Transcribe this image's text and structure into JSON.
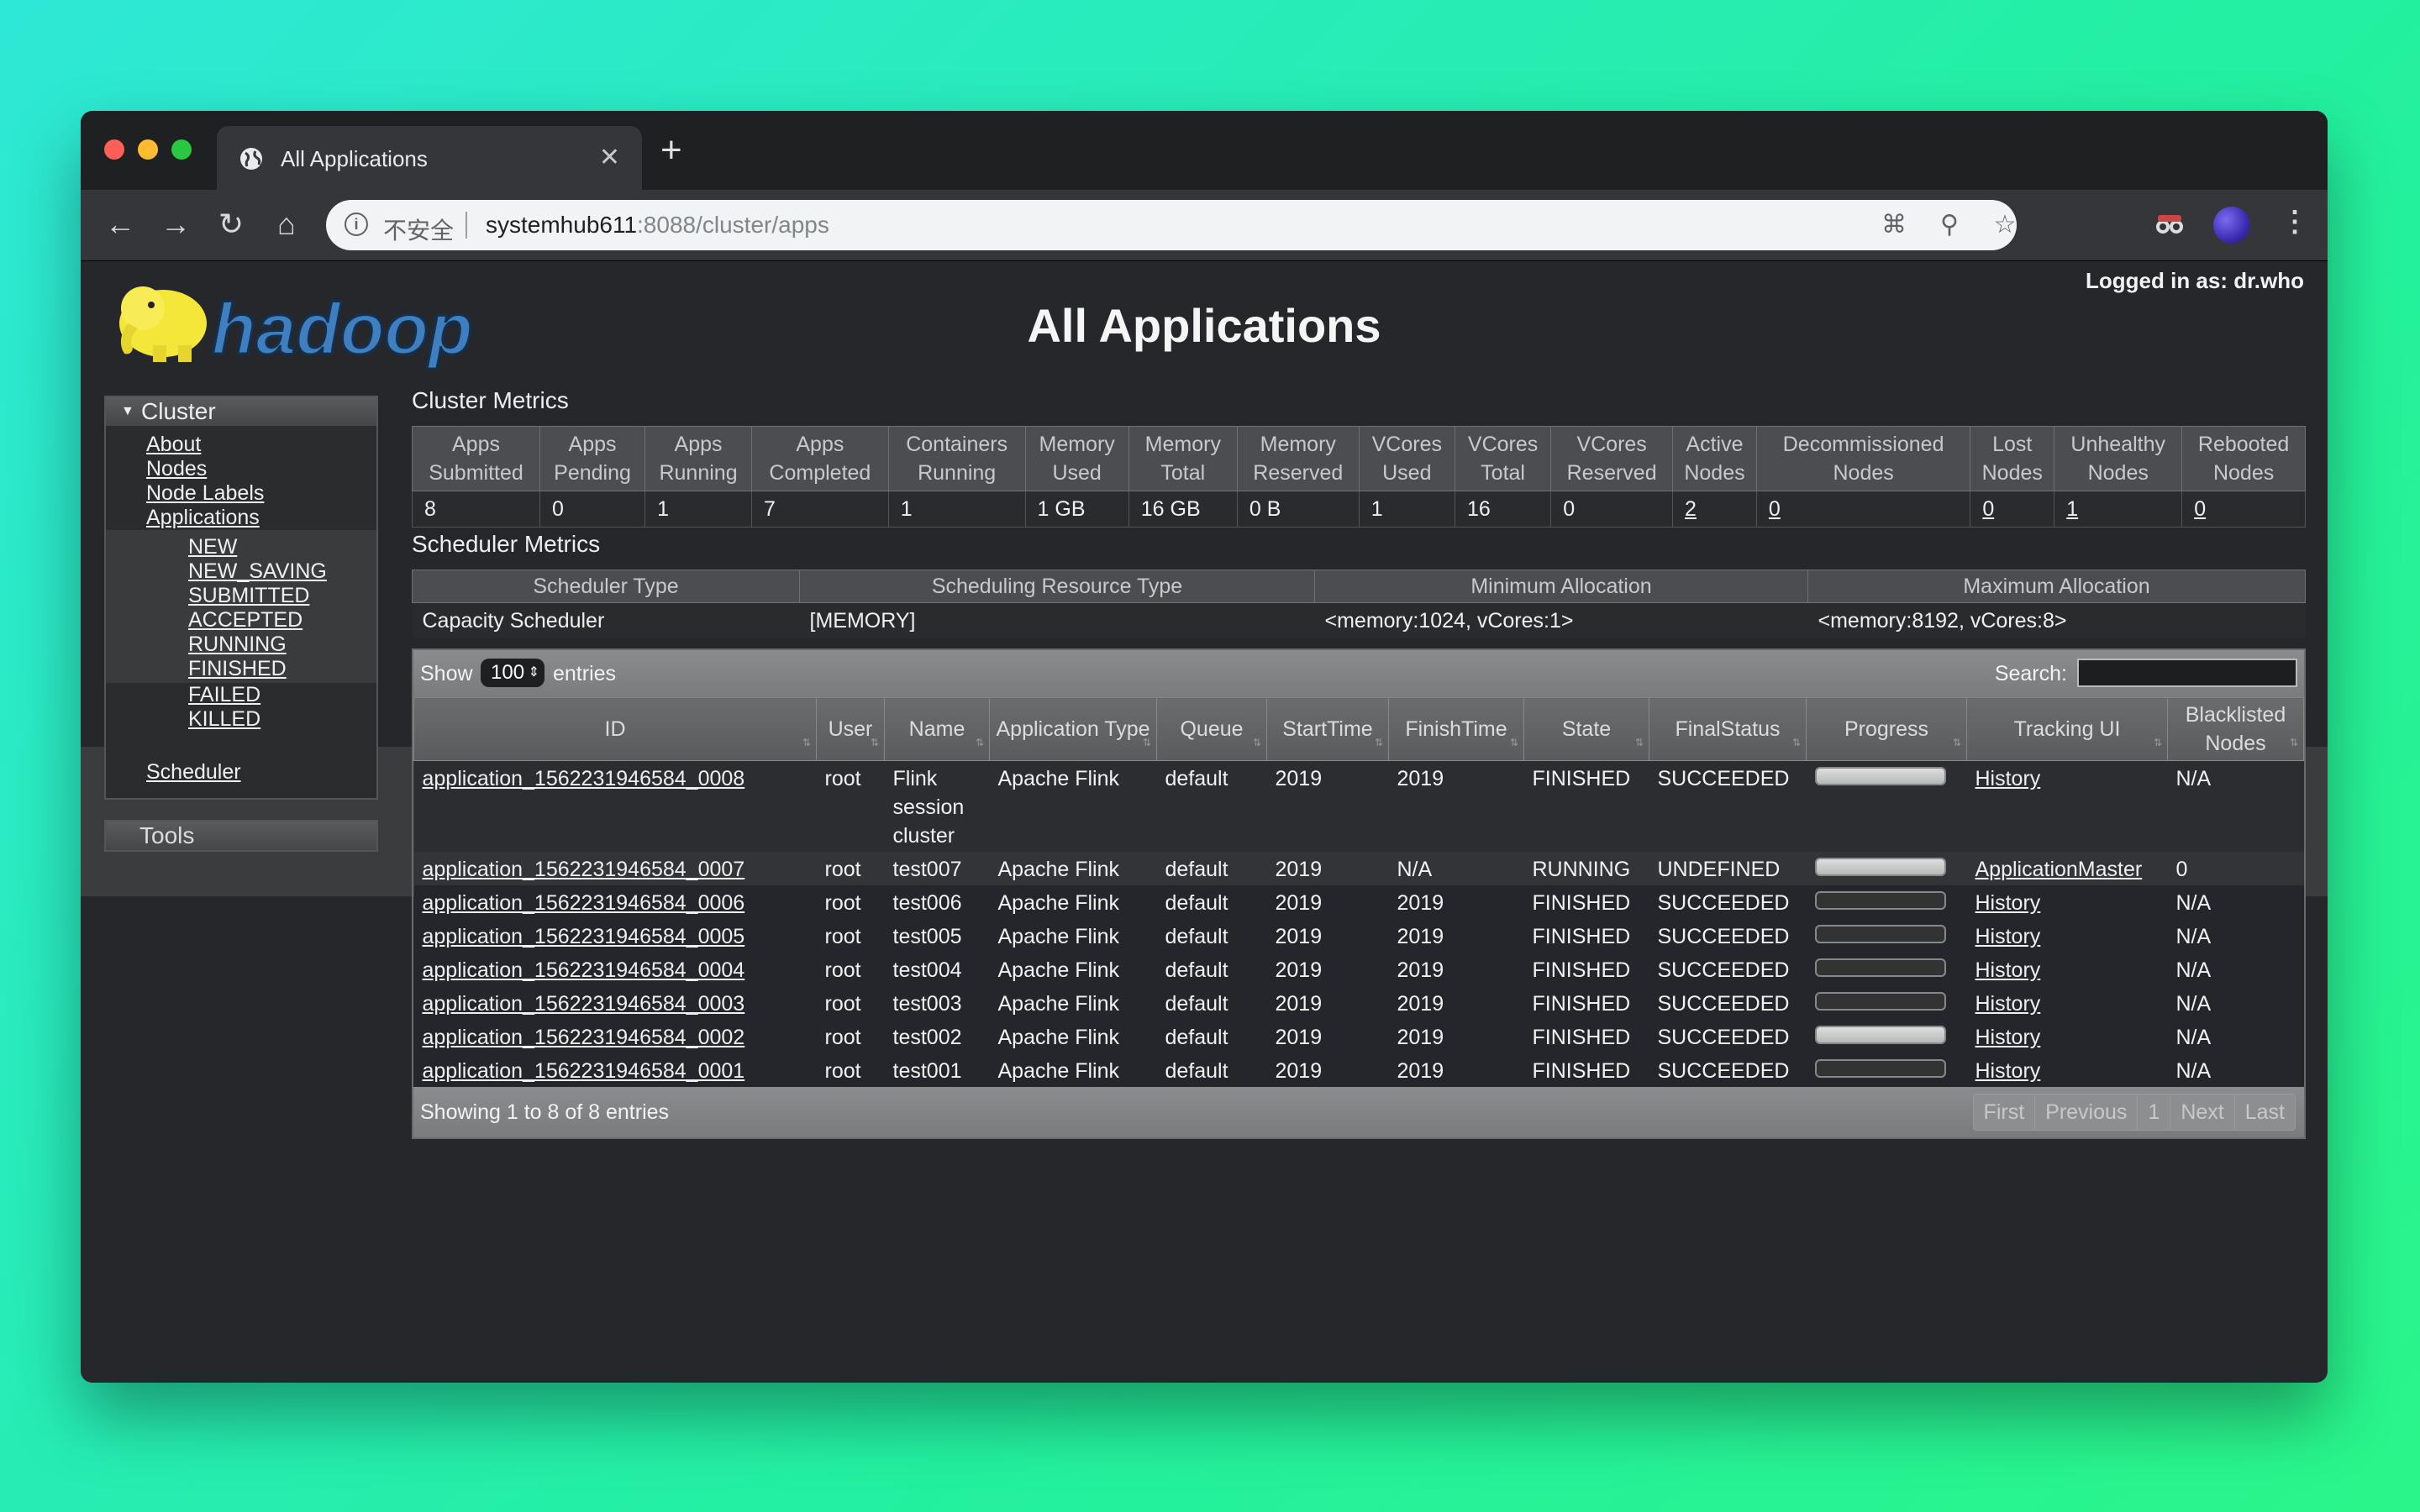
{
  "browser": {
    "tab_title": "All Applications",
    "insecure_label": "不安全",
    "url_host": "systemhub611",
    "url_rest": ":8088/cluster/apps"
  },
  "header": {
    "logged_in": "Logged in as: dr.who",
    "title": "All Applications",
    "logo_text": "hadoop"
  },
  "sidebar": {
    "cluster_label": "Cluster",
    "links": [
      "About",
      "Nodes",
      "Node Labels",
      "Applications"
    ],
    "states": [
      "NEW",
      "NEW_SAVING",
      "SUBMITTED",
      "ACCEPTED",
      "RUNNING",
      "FINISHED",
      "FAILED",
      "KILLED"
    ],
    "scheduler": "Scheduler",
    "tools_label": "Tools"
  },
  "cluster_metrics": {
    "title": "Cluster Metrics",
    "headers": [
      [
        "Apps",
        "Submitted"
      ],
      [
        "Apps",
        "Pending"
      ],
      [
        "Apps",
        "Running"
      ],
      [
        "Apps",
        "Completed"
      ],
      [
        "Containers",
        "Running"
      ],
      [
        "Memory",
        "Used"
      ],
      [
        "Memory",
        "Total"
      ],
      [
        "Memory",
        "Reserved"
      ],
      [
        "VCores",
        "Used"
      ],
      [
        "VCores",
        "Total"
      ],
      [
        "VCores",
        "Reserved"
      ],
      [
        "Active",
        "Nodes"
      ],
      [
        "Decommissioned",
        "Nodes"
      ],
      [
        "Lost",
        "Nodes"
      ],
      [
        "Unhealthy",
        "Nodes"
      ],
      [
        "Rebooted",
        "Nodes"
      ]
    ],
    "values": [
      "8",
      "0",
      "1",
      "7",
      "1",
      "1 GB",
      "16 GB",
      "0 B",
      "1",
      "16",
      "0",
      "2",
      "0",
      "0",
      "1",
      "0"
    ]
  },
  "scheduler_metrics": {
    "title": "Scheduler Metrics",
    "headers": [
      "Scheduler Type",
      "Scheduling Resource Type",
      "Minimum Allocation",
      "Maximum Allocation"
    ],
    "values": [
      "Capacity Scheduler",
      "[MEMORY]",
      "<memory:1024, vCores:1>",
      "<memory:8192, vCores:8>"
    ]
  },
  "apps_table": {
    "show_label": "Show",
    "show_value": "100",
    "entries_label": "entries",
    "search_label": "Search:",
    "headers": [
      "ID",
      "User",
      "Name",
      "Application Type",
      "Queue",
      "StartTime",
      "FinishTime",
      "State",
      "FinalStatus",
      "Progress",
      "Tracking UI",
      "Blacklisted Nodes"
    ],
    "rows": [
      {
        "id": "application_1562231946584_0008",
        "user": "root",
        "name": "Flink session cluster",
        "type": "Apache Flink",
        "queue": "default",
        "start": "2019",
        "finish": "2019",
        "state": "FINISHED",
        "final": "SUCCEEDED",
        "progress": 100,
        "tracking": "History",
        "blacklisted": "N/A"
      },
      {
        "id": "application_1562231946584_0007",
        "user": "root",
        "name": "test007",
        "type": "Apache Flink",
        "queue": "default",
        "start": "2019",
        "finish": "N/A",
        "state": "RUNNING",
        "final": "UNDEFINED",
        "progress": 100,
        "tracking": "ApplicationMaster",
        "blacklisted": "0"
      },
      {
        "id": "application_1562231946584_0006",
        "user": "root",
        "name": "test006",
        "type": "Apache Flink",
        "queue": "default",
        "start": "2019",
        "finish": "2019",
        "state": "FINISHED",
        "final": "SUCCEEDED",
        "progress": 0,
        "tracking": "History",
        "blacklisted": "N/A"
      },
      {
        "id": "application_1562231946584_0005",
        "user": "root",
        "name": "test005",
        "type": "Apache Flink",
        "queue": "default",
        "start": "2019",
        "finish": "2019",
        "state": "FINISHED",
        "final": "SUCCEEDED",
        "progress": 0,
        "tracking": "History",
        "blacklisted": "N/A"
      },
      {
        "id": "application_1562231946584_0004",
        "user": "root",
        "name": "test004",
        "type": "Apache Flink",
        "queue": "default",
        "start": "2019",
        "finish": "2019",
        "state": "FINISHED",
        "final": "SUCCEEDED",
        "progress": 0,
        "tracking": "History",
        "blacklisted": "N/A"
      },
      {
        "id": "application_1562231946584_0003",
        "user": "root",
        "name": "test003",
        "type": "Apache Flink",
        "queue": "default",
        "start": "2019",
        "finish": "2019",
        "state": "FINISHED",
        "final": "SUCCEEDED",
        "progress": 0,
        "tracking": "History",
        "blacklisted": "N/A"
      },
      {
        "id": "application_1562231946584_0002",
        "user": "root",
        "name": "test002",
        "type": "Apache Flink",
        "queue": "default",
        "start": "2019",
        "finish": "2019",
        "state": "FINISHED",
        "final": "SUCCEEDED",
        "progress": 100,
        "tracking": "History",
        "blacklisted": "N/A"
      },
      {
        "id": "application_1562231946584_0001",
        "user": "root",
        "name": "test001",
        "type": "Apache Flink",
        "queue": "default",
        "start": "2019",
        "finish": "2019",
        "state": "FINISHED",
        "final": "SUCCEEDED",
        "progress": 0,
        "tracking": "History",
        "blacklisted": "N/A"
      }
    ],
    "showing": "Showing 1 to 8 of 8 entries",
    "pager": [
      "First",
      "Previous",
      "1",
      "Next",
      "Last"
    ]
  }
}
